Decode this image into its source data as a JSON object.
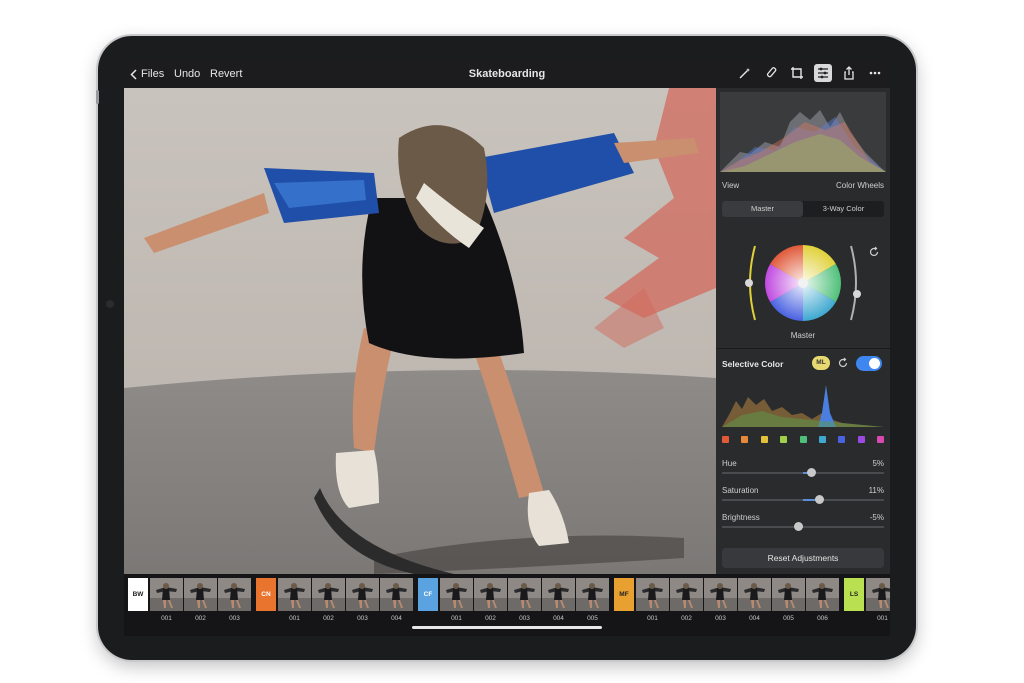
{
  "topbar": {
    "back_label": "Files",
    "undo_label": "Undo",
    "revert_label": "Revert",
    "title": "Skateboarding",
    "tools": [
      "ml-wand-icon",
      "brush-icon",
      "crop-icon",
      "adjustments-icon",
      "share-icon",
      "more-icon"
    ]
  },
  "panel": {
    "view_label": "View",
    "view_value": "Color Wheels",
    "tabs": [
      "Master",
      "3-Way Color"
    ],
    "active_tab": "Master",
    "wheel_label": "Master",
    "selective_color": {
      "title": "Selective Color",
      "ml_badge": "ML",
      "enabled": true
    },
    "swatch_colors": [
      "#e05a3a",
      "#e8883a",
      "#e2c23a",
      "#9fd04a",
      "#4fc07a",
      "#3fa8d0",
      "#4a62e0",
      "#9a4ae0",
      "#d84ab0"
    ],
    "sliders": [
      {
        "name": "Hue",
        "value": "5%",
        "level": 0.55
      },
      {
        "name": "Saturation",
        "value": "11%",
        "level": 0.6
      },
      {
        "name": "Brightness",
        "value": "-5%",
        "level": 0.47
      }
    ],
    "reset_label": "Reset Adjustments"
  },
  "filmstrip": {
    "groups": [
      {
        "code": "BW",
        "color": "#ffffff",
        "text_color": "#222222",
        "items": [
          "001",
          "002",
          "003"
        ]
      },
      {
        "code": "CN",
        "color": "#e8742e",
        "text_color": "#ffffff",
        "items": [
          "001",
          "002",
          "003",
          "004"
        ]
      },
      {
        "code": "CF",
        "color": "#5aa3e0",
        "text_color": "#ffffff",
        "items": [
          "001",
          "002",
          "003",
          "004",
          "005"
        ]
      },
      {
        "code": "MF",
        "color": "#e8a030",
        "text_color": "#222222",
        "items": [
          "001",
          "002",
          "003",
          "004",
          "005",
          "006"
        ]
      },
      {
        "code": "LS",
        "color": "#b8e050",
        "text_color": "#222222",
        "items": [
          "001"
        ]
      }
    ]
  }
}
